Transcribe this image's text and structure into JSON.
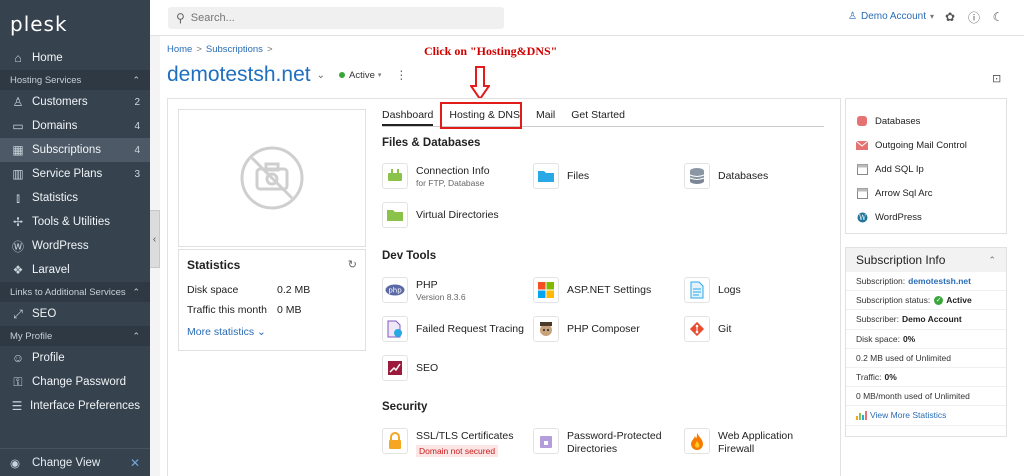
{
  "sidebar": {
    "logo": "plesk",
    "home": "Home",
    "sections": {
      "hosting": "Hosting Services",
      "links": "Links to Additional Services",
      "profile": "My Profile"
    },
    "items": [
      {
        "label": "Customers",
        "count": "2"
      },
      {
        "label": "Domains",
        "count": "4"
      },
      {
        "label": "Subscriptions",
        "count": "4"
      },
      {
        "label": "Service Plans",
        "count": "3"
      },
      {
        "label": "Statistics",
        "count": ""
      },
      {
        "label": "Tools & Utilities",
        "count": ""
      },
      {
        "label": "WordPress",
        "count": ""
      },
      {
        "label": "Laravel",
        "count": ""
      }
    ],
    "seo": "SEO",
    "profile_items": [
      "Profile",
      "Change Password",
      "Interface Preferences"
    ],
    "change_view": "Change View"
  },
  "topbar": {
    "search_placeholder": "Search...",
    "account": "Demo Account"
  },
  "breadcrumb": [
    "Home",
    "Subscriptions"
  ],
  "page": {
    "title": "demotestsh.net",
    "status": "Active"
  },
  "annotation": "Click on \"Hosting&DNS\"",
  "statistics": {
    "title": "Statistics",
    "disk_label": "Disk space",
    "disk_value": "0.2 MB",
    "traffic_label": "Traffic this month",
    "traffic_value": "0 MB",
    "more": "More statistics"
  },
  "tabs": [
    "Dashboard",
    "Hosting & DNS",
    "Mail",
    "Get Started"
  ],
  "sections": {
    "files": "Files & Databases",
    "dev": "Dev Tools",
    "security": "Security"
  },
  "tools": {
    "connection_info": {
      "name": "Connection Info",
      "sub": "for FTP, Database"
    },
    "files": {
      "name": "Files"
    },
    "databases": {
      "name": "Databases"
    },
    "virtual_dirs": {
      "name": "Virtual Directories"
    },
    "php": {
      "name": "PHP",
      "sub": "Version 8.3.6"
    },
    "aspnet": {
      "name": "ASP.NET Settings"
    },
    "logs": {
      "name": "Logs"
    },
    "failed_req": {
      "name": "Failed Request Tracing"
    },
    "composer": {
      "name": "PHP Composer"
    },
    "git": {
      "name": "Git"
    },
    "seo": {
      "name": "SEO"
    },
    "ssl": {
      "name": "SSL/TLS Certificates",
      "badge": "Domain not secured"
    },
    "pwd_dirs": {
      "name": "Password-Protected",
      "name2": "Directories"
    },
    "waf": {
      "name": "Web Application",
      "name2": "Firewall"
    }
  },
  "right_links": [
    "Databases",
    "Outgoing Mail Control",
    "Add SQL Ip",
    "Arrow Sql Arc",
    "WordPress"
  ],
  "subscription_info": {
    "title": "Subscription Info",
    "subscription_label": "Subscription:",
    "subscription_value": "demotestsh.net",
    "status_label": "Subscription status:",
    "status_value": "Active",
    "subscriber_label": "Subscriber:",
    "subscriber_value": "Demo Account",
    "disk_label": "Disk space:",
    "disk_value": "0%",
    "disk_used": "0.2 MB used of Unlimited",
    "traffic_label": "Traffic:",
    "traffic_value": "0%",
    "traffic_used": "0 MB/month used of Unlimited",
    "more": "View More Statistics"
  }
}
